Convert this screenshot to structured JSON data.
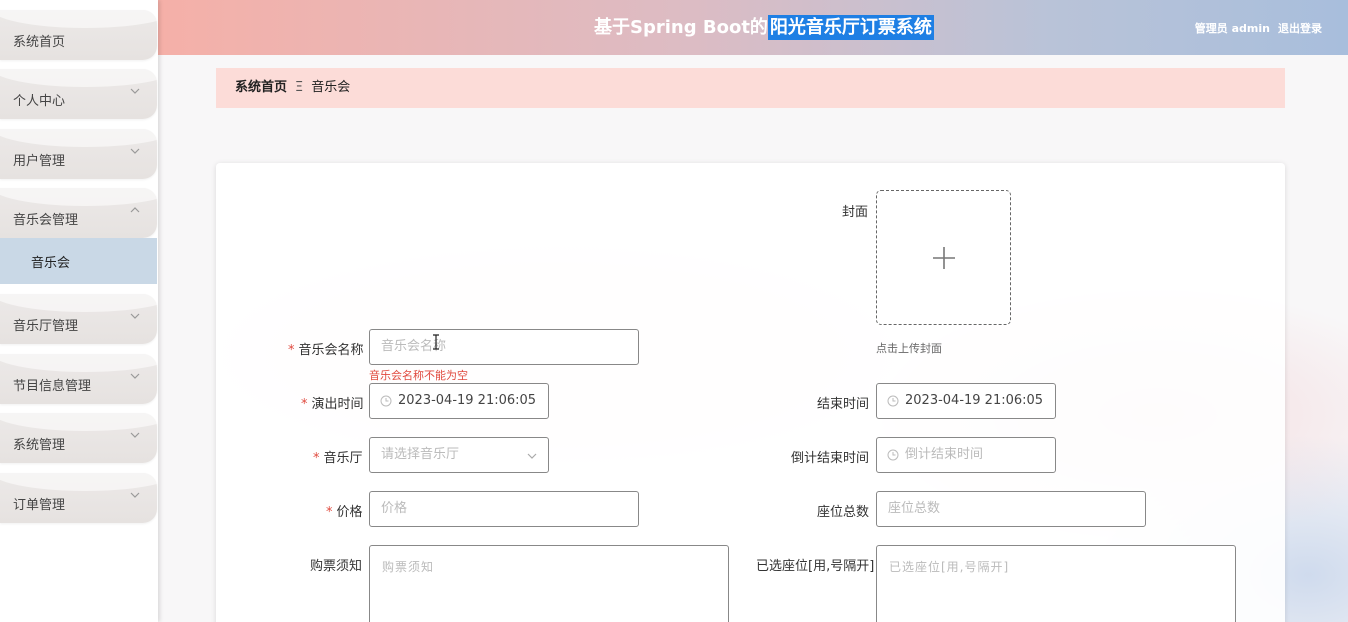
{
  "sidebar": {
    "items": [
      {
        "label": "系统首页",
        "chevron": ""
      },
      {
        "label": "个人中心",
        "chevron": "chevron-down"
      },
      {
        "label": "用户管理",
        "chevron": "chevron-down"
      },
      {
        "label": "音乐会管理",
        "chevron": "chevron-up"
      },
      {
        "label": "音乐厅管理",
        "chevron": "chevron-down"
      },
      {
        "label": "节目信息管理",
        "chevron": "chevron-down"
      },
      {
        "label": "系统管理",
        "chevron": "chevron-down"
      },
      {
        "label": "订单管理",
        "chevron": "chevron-down"
      }
    ],
    "active_submenu": "音乐会"
  },
  "header": {
    "title_prefix": "基于Spring Boot的",
    "title_highlight": "阳光音乐厅订票系统",
    "user": "管理员 admin",
    "logout": "退出登录",
    "highlight_color": "#1e7fe4"
  },
  "breadcrumb": {
    "home": "系统首页",
    "separator": "Ξ",
    "current": "音乐会"
  },
  "form": {
    "cover_label": "封面",
    "cover_hint": "点击上传封面",
    "name_label": "音乐会名称",
    "name_placeholder": "音乐会名称",
    "name_error": "音乐会名称不能为空",
    "start_label": "演出时间",
    "start_value": "2023-04-19 21:06:05",
    "end_label": "结束时间",
    "end_value": "2023-04-19 21:06:05",
    "hall_label": "音乐厅",
    "hall_placeholder": "请选择音乐厅",
    "countdown_label": "倒计结束时间",
    "countdown_placeholder": "倒计结束时间",
    "price_label": "价格",
    "price_placeholder": "价格",
    "seats_label": "座位总数",
    "seats_placeholder": "座位总数",
    "notice_label": "购票须知",
    "notice_placeholder": "购票须知",
    "selected_label": "已选座位[用,号隔开]",
    "selected_placeholder": "已选座位[用,号隔开]",
    "required_mark": "*",
    "error_color": "#e04a3f"
  }
}
